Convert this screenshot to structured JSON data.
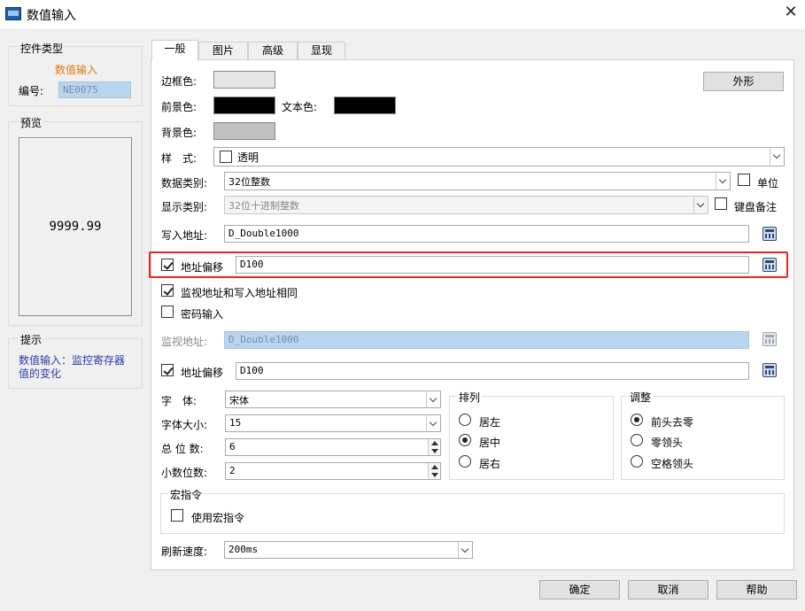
{
  "window": {
    "title": "数值输入"
  },
  "left": {
    "control_type": {
      "heading": "控件类型",
      "type_name": "数值输入",
      "id_label": "编号:",
      "id_value": "NE0075"
    },
    "preview": {
      "heading": "预览",
      "value": "9999.99"
    },
    "hint": {
      "heading": "提示",
      "text": "数值输入：监控寄存器值的变化"
    }
  },
  "tabs": [
    "一般",
    "图片",
    "高级",
    "显现"
  ],
  "general": {
    "border_color_label": "边框色:",
    "fg_color_label": "前景色:",
    "text_color_label": "文本色:",
    "bg_color_label": "背景色:",
    "appearance_button": "外形",
    "style_label": "样　式:",
    "style_value": "透明",
    "data_type_label": "数据类别:",
    "data_type_value": "32位整数",
    "unit_label": "单位",
    "display_type_label": "显示类别:",
    "display_type_value": "32位十进制整数",
    "keyboard_note_label": "键盘备注",
    "write_addr_label": "写入地址:",
    "write_addr_value": "D_Double1000",
    "offset1_label": "地址偏移",
    "offset1_value": "D100",
    "same_addr_label": "监视地址和写入地址相同",
    "password_label": "密码输入",
    "monitor_addr_label": "监视地址:",
    "monitor_addr_value": "D_Double1000",
    "offset2_label": "地址偏移",
    "offset2_value": "D100",
    "font_label": "字　体:",
    "font_value": "宋体",
    "font_size_label": "字体大小:",
    "font_size_value": "15",
    "total_digits_label": "总 位 数:",
    "total_digits_value": "6",
    "decimal_digits_label": "小数位数:",
    "decimal_digits_value": "2",
    "align": {
      "heading": "排列",
      "options": [
        "居左",
        "居中",
        "居右"
      ],
      "selected": "居中"
    },
    "adjust": {
      "heading": "调整",
      "options": [
        "前头去零",
        "零领头",
        "空格领头"
      ],
      "selected": "前头去零"
    },
    "macro": {
      "heading": "宏指令",
      "use_label": "使用宏指令"
    },
    "refresh_label": "刷新速度:",
    "refresh_value": "200ms"
  },
  "colors": {
    "border": "#e6e6e6",
    "foreground": "#000000",
    "text": "#000000",
    "background": "#c0c0c0",
    "highlight": "#e8281e",
    "type_name": "#e07a10",
    "hint_text": "#2a3ca8"
  },
  "footer": {
    "ok": "确定",
    "cancel": "取消",
    "help": "帮助"
  }
}
